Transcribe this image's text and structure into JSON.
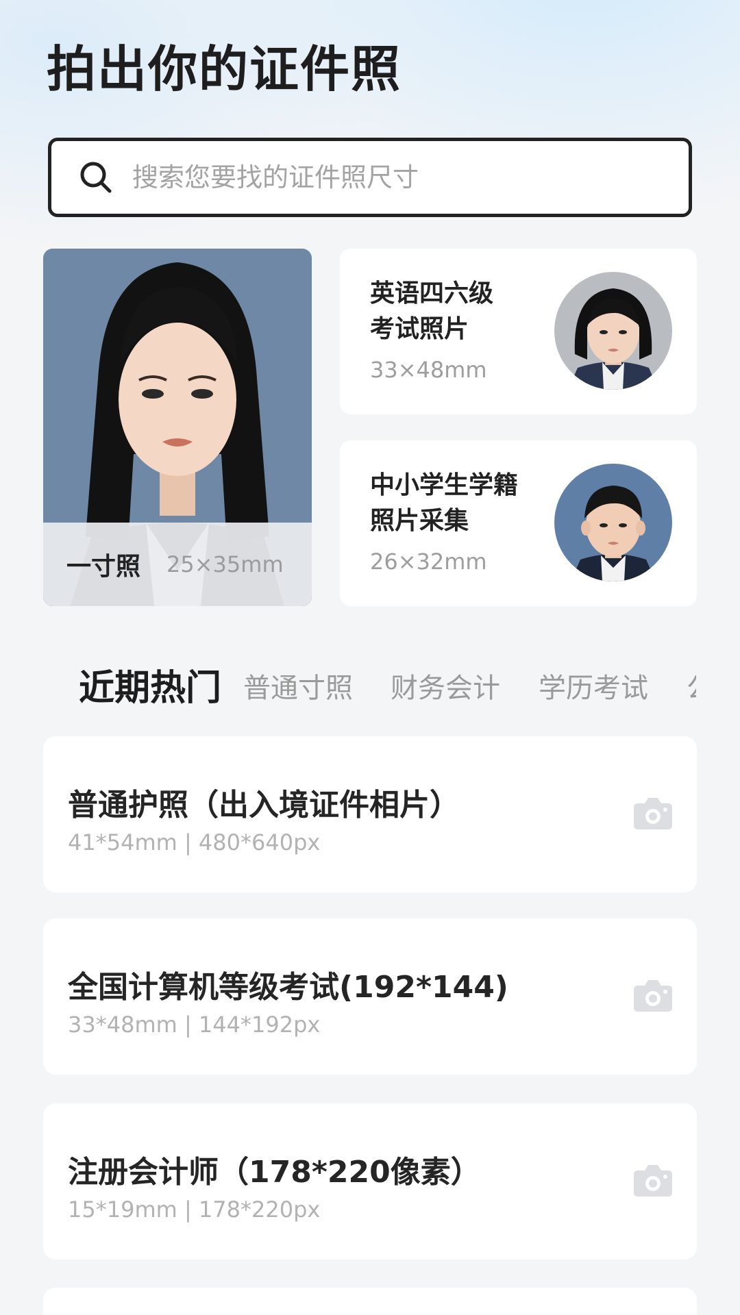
{
  "header": {
    "title": "拍出你的证件照"
  },
  "search": {
    "placeholder": "搜索您要找的证件照尺寸",
    "icon": "search-icon"
  },
  "featured": {
    "main": {
      "name": "一寸照",
      "size": "25×35mm"
    },
    "cards": [
      {
        "name_line1": "英语四六级",
        "name_line2": "考试照片",
        "size": "33×48mm"
      },
      {
        "name_line1": "中小学生学籍",
        "name_line2": "照片采集",
        "size": "26×32mm"
      }
    ]
  },
  "tabs": [
    {
      "label": "近期热门",
      "active": true
    },
    {
      "label": "普通寸照",
      "active": false
    },
    {
      "label": "财务会计",
      "active": false
    },
    {
      "label": "学历考试",
      "active": false
    },
    {
      "label": "公",
      "active": false
    }
  ],
  "list": [
    {
      "name": "普通护照（出入境证件相片）",
      "spec": "41*54mm | 480*640px",
      "icon": "camera-icon"
    },
    {
      "name": "全国计算机等级考试(192*144)",
      "spec": "33*48mm | 144*192px",
      "icon": "camera-icon"
    },
    {
      "name": "注册会计师（178*220像素）",
      "spec": "15*19mm | 178*220px",
      "icon": "camera-icon"
    }
  ],
  "colors": {
    "accent_text": "#1e1e1e",
    "muted_text": "#9d9d9d",
    "card_bg": "#ffffff",
    "page_bg": "#f4f5f7"
  }
}
